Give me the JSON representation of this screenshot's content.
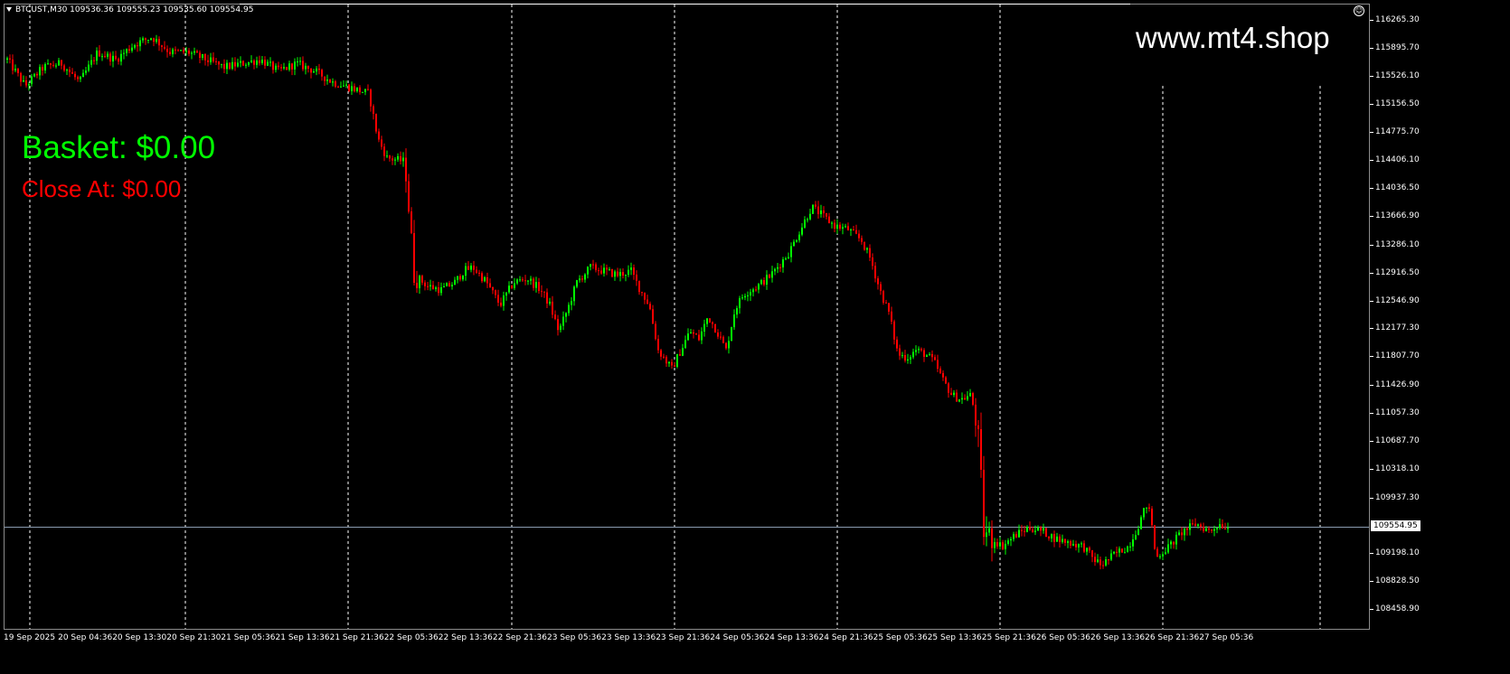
{
  "header": {
    "symbol_info": "BTCUST,M30  109536.36 109555.23 109535.60 109554.95",
    "menu_icon": "triangle-down-icon",
    "smiley_icon": "smiley-icon"
  },
  "watermark": "www.mt4.shop",
  "basket_label": "Basket: $0.00",
  "close_at_label": "Close At: $0.00",
  "current_price_label": "109554.95",
  "colors": {
    "background": "#000000",
    "bull": "#00ff00",
    "bear": "#ff0000",
    "grid": "#ffffff",
    "current_price_line": "#8a9bb0",
    "text": "#ffffff"
  },
  "y_axis_labels": [
    "116265.30",
    "115895.70",
    "115526.10",
    "115156.50",
    "114775.70",
    "114406.10",
    "114036.50",
    "113666.90",
    "113286.10",
    "112916.50",
    "112546.90",
    "112177.30",
    "111807.70",
    "111426.90",
    "111057.30",
    "110687.70",
    "110318.10",
    "109937.30",
    "109198.10",
    "108828.50",
    "108458.90"
  ],
  "x_axis_labels": [
    "19 Sep 2025",
    "20 Sep 04:36",
    "20 Sep 13:30",
    "20 Sep 21:30",
    "21 Sep 05:36",
    "21 Sep 13:36",
    "21 Sep 21:36",
    "22 Sep 05:36",
    "22 Sep 13:36",
    "22 Sep 21:36",
    "23 Sep 05:36",
    "23 Sep 13:36",
    "23 Sep 21:36",
    "24 Sep 05:36",
    "24 Sep 13:36",
    "24 Sep 21:36",
    "25 Sep 05:36",
    "25 Sep 13:36",
    "25 Sep 21:36",
    "26 Sep 05:36",
    "26 Sep 13:36",
    "26 Sep 21:36",
    "27 Sep 05:36"
  ],
  "chart_data": {
    "type": "candlestick",
    "symbol": "BTCUST",
    "timeframe": "M30",
    "ohlc_last": {
      "open": 109536.36,
      "high": 109555.23,
      "low": 109535.6,
      "close": 109554.95
    },
    "ylim": [
      108458.9,
      116265.3
    ],
    "current_price": 109554.95,
    "grid": "vertical dotted",
    "close_path": [
      [
        0,
        115750
      ],
      [
        20,
        115400
      ],
      [
        40,
        115650
      ],
      [
        60,
        115700
      ],
      [
        80,
        115450
      ],
      [
        100,
        115850
      ],
      [
        120,
        115750
      ],
      [
        140,
        115950
      ],
      [
        160,
        116050
      ],
      [
        180,
        115850
      ],
      [
        200,
        115850
      ],
      [
        220,
        115750
      ],
      [
        240,
        115650
      ],
      [
        260,
        115700
      ],
      [
        280,
        115750
      ],
      [
        300,
        115600
      ],
      [
        320,
        115700
      ],
      [
        340,
        115600
      ],
      [
        360,
        115450
      ],
      [
        380,
        115380
      ],
      [
        400,
        115300
      ],
      [
        410,
        114700
      ],
      [
        420,
        114450
      ],
      [
        440,
        114400
      ],
      [
        450,
        112900
      ],
      [
        465,
        112750
      ],
      [
        480,
        112700
      ],
      [
        495,
        112800
      ],
      [
        505,
        112950
      ],
      [
        515,
        113000
      ],
      [
        530,
        112800
      ],
      [
        545,
        112500
      ],
      [
        560,
        112800
      ],
      [
        575,
        112850
      ],
      [
        590,
        112700
      ],
      [
        600,
        112500
      ],
      [
        610,
        112150
      ],
      [
        620,
        112450
      ],
      [
        630,
        112800
      ],
      [
        645,
        113000
      ],
      [
        660,
        112950
      ],
      [
        675,
        112900
      ],
      [
        690,
        112950
      ],
      [
        700,
        112700
      ],
      [
        710,
        112500
      ],
      [
        720,
        111900
      ],
      [
        735,
        111650
      ],
      [
        745,
        111900
      ],
      [
        755,
        112150
      ],
      [
        765,
        112050
      ],
      [
        775,
        112350
      ],
      [
        785,
        112150
      ],
      [
        795,
        111900
      ],
      [
        805,
        112450
      ],
      [
        815,
        112650
      ],
      [
        830,
        112750
      ],
      [
        845,
        112900
      ],
      [
        855,
        113050
      ],
      [
        865,
        113200
      ],
      [
        875,
        113450
      ],
      [
        890,
        113800
      ],
      [
        900,
        113700
      ],
      [
        915,
        113550
      ],
      [
        930,
        113500
      ],
      [
        945,
        113350
      ],
      [
        955,
        113100
      ],
      [
        965,
        112700
      ],
      [
        975,
        112400
      ],
      [
        985,
        111850
      ],
      [
        995,
        111800
      ],
      [
        1005,
        111900
      ],
      [
        1015,
        111850
      ],
      [
        1025,
        111750
      ],
      [
        1035,
        111500
      ],
      [
        1045,
        111300
      ],
      [
        1055,
        111250
      ],
      [
        1065,
        111300
      ],
      [
        1070,
        111100
      ],
      [
        1075,
        110600
      ],
      [
        1080,
        109500
      ],
      [
        1090,
        109400
      ],
      [
        1100,
        109300
      ],
      [
        1115,
        109450
      ],
      [
        1130,
        109550
      ],
      [
        1145,
        109500
      ],
      [
        1160,
        109400
      ],
      [
        1175,
        109350
      ],
      [
        1190,
        109300
      ],
      [
        1200,
        109150
      ],
      [
        1210,
        109050
      ],
      [
        1225,
        109200
      ],
      [
        1240,
        109300
      ],
      [
        1250,
        109550
      ],
      [
        1260,
        109850
      ],
      [
        1265,
        109700
      ],
      [
        1270,
        109150
      ],
      [
        1285,
        109300
      ],
      [
        1300,
        109500
      ],
      [
        1315,
        109600
      ],
      [
        1330,
        109500
      ],
      [
        1340,
        109600
      ],
      [
        1350,
        109554.95
      ]
    ]
  }
}
